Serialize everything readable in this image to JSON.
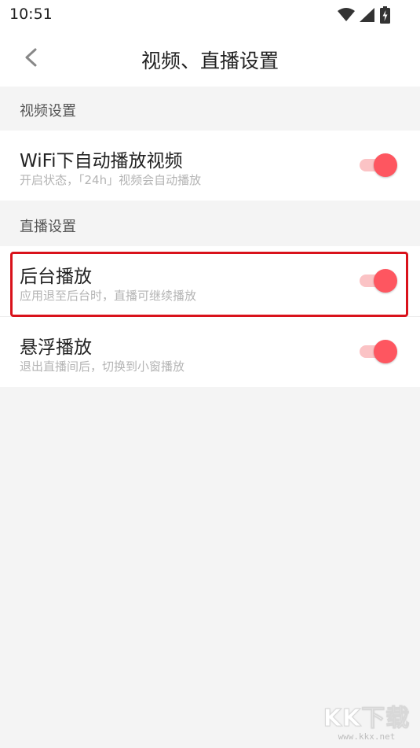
{
  "status_bar": {
    "time": "10:51",
    "icons": [
      "wifi-icon",
      "signal-icon",
      "battery-charging-icon"
    ]
  },
  "app_bar": {
    "back_icon": "chevron-left-icon",
    "title": "视频、直播设置"
  },
  "sections": [
    {
      "header": "视频设置",
      "rows": [
        {
          "title": "WiFi下自动播放视频",
          "description": "开启状态，「24h」视频会自动播放",
          "enabled": true
        }
      ]
    },
    {
      "header": "直播设置",
      "rows": [
        {
          "title": "后台播放",
          "description": "应用退至后台时，直播可继续播放",
          "enabled": true
        },
        {
          "title": "悬浮播放",
          "description": "退出直播间后，切换到小窗播放",
          "enabled": true
        }
      ]
    }
  ],
  "colors": {
    "accent": "#fe5660",
    "accent_track": "#fbc3c5",
    "highlight_border": "#d9121b",
    "background": "#f4f4f4"
  },
  "watermark": {
    "logo": "KK下载",
    "url": "www.kkx.net"
  }
}
